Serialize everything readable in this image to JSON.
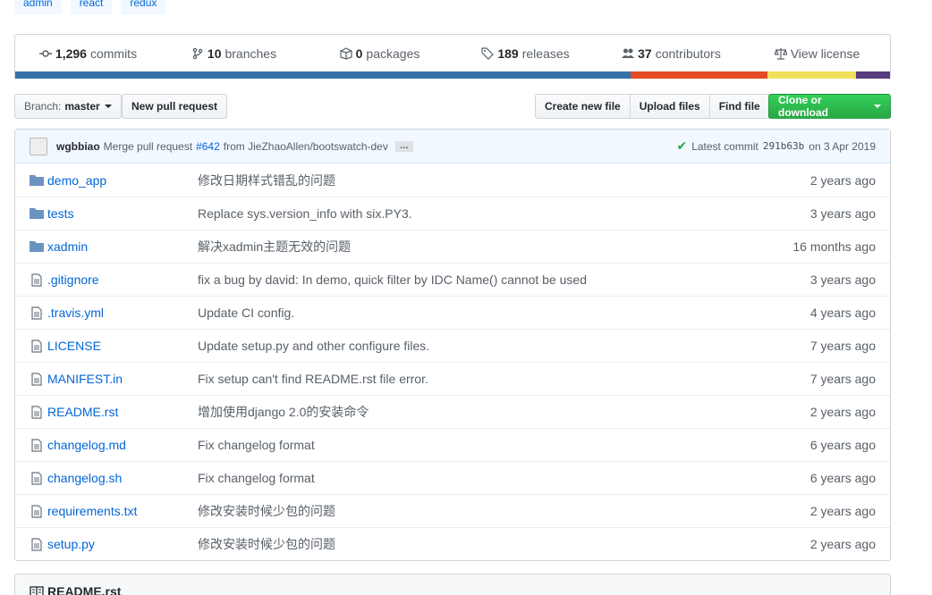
{
  "topics": [
    "admin",
    "react",
    "redux"
  ],
  "stats": {
    "commits": {
      "count": "1,296",
      "label": "commits",
      "icon": "commit-icon"
    },
    "branches": {
      "count": "10",
      "label": "branches",
      "icon": "branch-icon"
    },
    "packages": {
      "count": "0",
      "label": "packages",
      "icon": "package-icon"
    },
    "releases": {
      "count": "189",
      "label": "releases",
      "icon": "tag-icon"
    },
    "contributors": {
      "count": "37",
      "label": "contributors",
      "icon": "people-icon"
    },
    "license": {
      "label": "View license",
      "icon": "law-icon"
    }
  },
  "language_colors": [
    "#3572A5",
    "#e34c26",
    "#f1e05a",
    "#563d7c"
  ],
  "language_fraction": [
    0.703,
    0.157,
    0.101,
    0.039
  ],
  "toolbar": {
    "branch_prefix": "Branch:",
    "branch_name": "master",
    "new_pr": "New pull request",
    "create_file": "Create new file",
    "upload_files": "Upload files",
    "find_file": "Find file",
    "clone": "Clone or download"
  },
  "commit": {
    "author": "wgbbiao",
    "message_prefix": "Merge pull request",
    "pr_link": "#642",
    "message_suffix": "from JieZhaoAllen/bootswatch-dev",
    "ellipsis": "…",
    "latest_label": "Latest commit",
    "sha": "291b63b",
    "date": "on 3 Apr 2019",
    "status_color": "#28a745"
  },
  "files": [
    {
      "type": "dir",
      "name": "demo_app",
      "message": "修改日期样式错乱的问题",
      "age": "2 years ago"
    },
    {
      "type": "dir",
      "name": "tests",
      "message": "Replace sys.version_info with six.PY3.",
      "age": "3 years ago"
    },
    {
      "type": "dir",
      "name": "xadmin",
      "message": "解决xadmin主题无效的问题",
      "age": "16 months ago"
    },
    {
      "type": "file",
      "name": ".gitignore",
      "message": "fix a bug by david: In demo, quick filter by IDC Name() cannot be used",
      "age": "3 years ago"
    },
    {
      "type": "file",
      "name": ".travis.yml",
      "message": "Update CI config.",
      "age": "4 years ago"
    },
    {
      "type": "file",
      "name": "LICENSE",
      "message": "Update setup.py and other configure files.",
      "age": "7 years ago"
    },
    {
      "type": "file",
      "name": "MANIFEST.in",
      "message": "Fix setup can't find README.rst file error.",
      "age": "7 years ago"
    },
    {
      "type": "file",
      "name": "README.rst",
      "message": "增加使用django 2.0的安装命令",
      "age": "2 years ago"
    },
    {
      "type": "file",
      "name": "changelog.md",
      "message": "Fix changelog format",
      "age": "6 years ago"
    },
    {
      "type": "file",
      "name": "changelog.sh",
      "message": "Fix changelog format",
      "age": "6 years ago"
    },
    {
      "type": "file",
      "name": "requirements.txt",
      "message": "修改安装时候少包的问题",
      "age": "2 years ago"
    },
    {
      "type": "file",
      "name": "setup.py",
      "message": "修改安装时候少包的问题",
      "age": "2 years ago"
    }
  ],
  "readme": {
    "title": "README.rst",
    "icon": "book-icon"
  }
}
